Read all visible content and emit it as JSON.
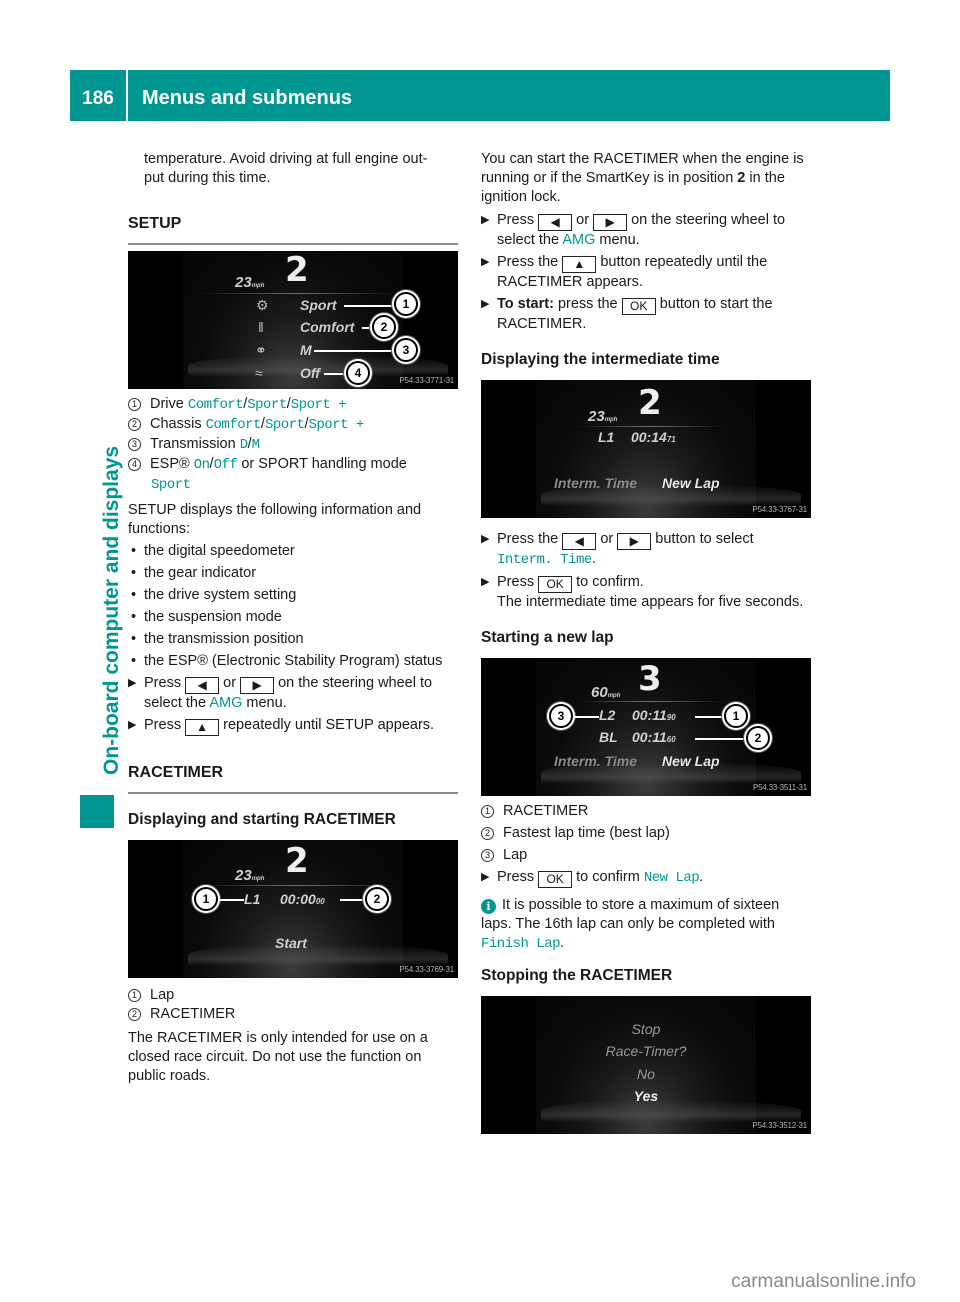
{
  "header": {
    "page_number": "186",
    "title": "Menus and submenus"
  },
  "side_tab": {
    "label": "On-board computer and displays"
  },
  "left": {
    "intro": [
      "temperature. Avoid driving at full engine out-",
      "put during this time."
    ],
    "setup": {
      "heading": "SETUP",
      "screen": {
        "gear": "2",
        "speed": "23",
        "speed_unit": "mph",
        "rows": [
          {
            "icon": "drive-icon",
            "glyph": "⚙",
            "value": "Sport",
            "callout": "1"
          },
          {
            "icon": "suspension-icon",
            "glyph": "‖",
            "value": "Comfort",
            "callout": "2"
          },
          {
            "icon": "transmission-icon",
            "glyph": "⚭",
            "value": "M",
            "callout": "3"
          },
          {
            "icon": "esp-icon",
            "glyph": "≈",
            "value": "Off",
            "callout": "4"
          }
        ],
        "code": "P54.33-3771-31"
      },
      "legend": [
        {
          "num": "1",
          "label": "Drive",
          "options": [
            "Comfort",
            "Sport",
            "Sport +"
          ]
        },
        {
          "num": "2",
          "label": "Chassis",
          "options": [
            "Comfort",
            "Sport",
            "Sport +"
          ]
        },
        {
          "num": "3",
          "label": "Transmission",
          "options": [
            "D",
            "M"
          ]
        },
        {
          "num": "4",
          "label": "ESP®",
          "options": [
            "On",
            "Off"
          ],
          "suffix": "or SPORT handling mode",
          "extra": "Sport"
        }
      ],
      "description": "SETUP displays the following information and functions:",
      "bullets": [
        "the digital speedometer",
        "the gear indicator",
        "the drive system setting",
        "the suspension mode",
        "the transmission position",
        "the ESP® (Electronic Stability Program) status"
      ],
      "steps": [
        {
          "pre": "Press",
          "key1": "◀",
          "mid": "or",
          "key2": "▶",
          "post": "on the steering wheel to select the",
          "highlight": "AMG",
          "end": "menu."
        },
        {
          "pre": "Press",
          "key1": "▲",
          "post": "repeatedly until SETUP appears."
        }
      ]
    },
    "racetimer": {
      "heading": "RACETIMER",
      "subheading": "Displaying and starting RACETIMER",
      "screen": {
        "gear": "2",
        "speed": "23",
        "speed_unit": "mph",
        "lap": "L1",
        "time": "00:00",
        "hundredths": "00",
        "action": "Start",
        "code": "P54.33-3769-31",
        "callouts": [
          "1",
          "2"
        ]
      },
      "legend": [
        {
          "num": "1",
          "label": "Lap"
        },
        {
          "num": "2",
          "label": "RACETIMER"
        }
      ],
      "note": "The RACETIMER is only intended for use on a closed race circuit. Do not use the function on public roads."
    }
  },
  "right": {
    "intro": {
      "text1": "You can start the RACETIMER when the engine is running or if the SmartKey is in position",
      "bold": "2",
      "text2": "in the ignition lock."
    },
    "steps": [
      {
        "pre": "Press",
        "key1": "◀",
        "mid": "or",
        "key2": "▶",
        "post": "on the steering wheel to select the",
        "highlight": "AMG",
        "end": "menu."
      },
      {
        "pre": "Press the",
        "key1": "▲",
        "post": "button repeatedly until the RACETIMER appears."
      },
      {
        "bold": "To start:",
        "pre": "press the",
        "key1": "OK",
        "post": "button to start the RACETIMER."
      }
    ],
    "intermediate": {
      "heading": "Displaying the intermediate time",
      "screen": {
        "gear": "2",
        "speed": "23",
        "speed_unit": "mph",
        "lap": "L1",
        "time": "00:14",
        "hundredths": "71",
        "menu_left": "Interm. Time",
        "menu_right": "New Lap",
        "code": "P54.33-3767-31"
      },
      "steps": [
        {
          "pre": "Press the",
          "key1": "◀",
          "mid": "or",
          "key2": "▶",
          "post": "button to select",
          "highlight": "Interm. Time",
          "end": "."
        },
        {
          "pre": "Press",
          "key1": "OK",
          "post": "to confirm.",
          "result": "The intermediate time appears for five seconds."
        }
      ]
    },
    "newlap": {
      "heading": "Starting a new lap",
      "screen": {
        "gear": "3",
        "speed": "60",
        "speed_unit": "mph",
        "lap": "L2",
        "time": "00:11",
        "hundredths": "90",
        "best_label": "BL",
        "best_time": "00:11",
        "best_hundredths": "60",
        "menu_left": "Interm. Time",
        "menu_right": "New Lap",
        "code": "P54.33-3511-31",
        "callouts": [
          "1",
          "2",
          "3"
        ]
      },
      "legend": [
        {
          "num": "1",
          "label": "RACETIMER"
        },
        {
          "num": "2",
          "label": "Fastest lap time (best lap)"
        },
        {
          "num": "3",
          "label": "Lap"
        }
      ],
      "step": {
        "pre": "Press",
        "key1": "OK",
        "post": "to confirm",
        "highlight": "New Lap",
        "end": "."
      },
      "info": {
        "text": "It is possible to store a maximum of sixteen laps. The 16th lap can only be completed with",
        "highlight": "Finish Lap",
        "end": "."
      }
    },
    "stop": {
      "heading": "Stopping the RACETIMER",
      "screen": {
        "line1": "Stop",
        "line2": "Race-Timer?",
        "option_no": "No",
        "option_yes": "Yes",
        "code": "P54.33-3512-31"
      }
    }
  },
  "watermark": "carmanualsonline.info",
  "colors": {
    "accent": "#009792",
    "rule": "#8a8a8a",
    "screen_bg": "#000000"
  }
}
